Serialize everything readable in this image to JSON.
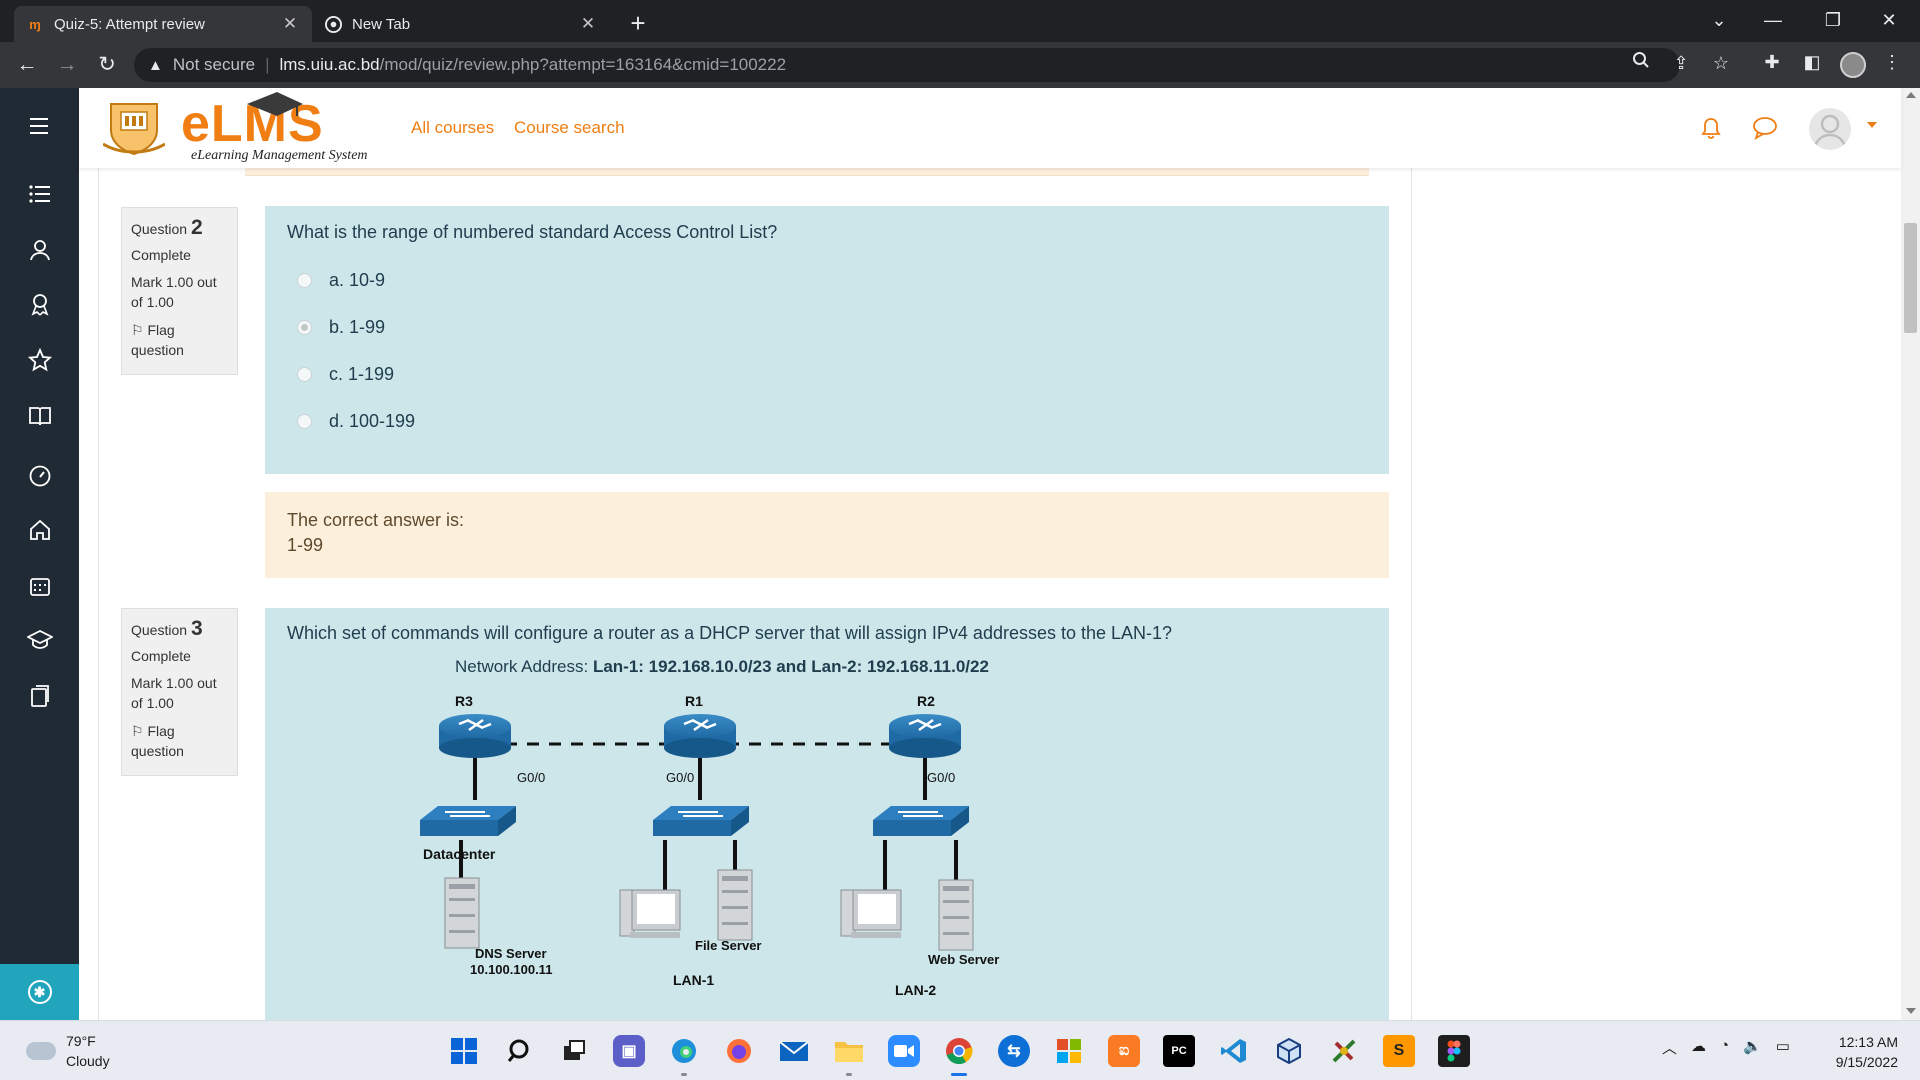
{
  "browser": {
    "tabs": [
      {
        "title": "Quiz-5: Attempt review",
        "active": true,
        "favicon": "elms-favicon"
      },
      {
        "title": "New Tab",
        "active": false,
        "favicon": "chrome-favicon"
      }
    ],
    "address": {
      "security": "Not secure",
      "host": "lms.uiu.ac.bd",
      "path": "/mod/quiz/review.php?attempt=163164&cmid=100222"
    }
  },
  "site": {
    "logo_text": "eLMS",
    "logo_subtitle": "eLearning Management System",
    "nav": [
      "All courses",
      "Course search"
    ],
    "accent": "#f07e12"
  },
  "questions": [
    {
      "number_label": "Question",
      "number": "2",
      "state": "Complete",
      "grade": "Mark 1.00 out of 1.00",
      "flag": "Flag question",
      "text": "What is the range of numbered standard Access Control List?",
      "answers": [
        {
          "label": "a. 10-9",
          "checked": false
        },
        {
          "label": "b. 1-99",
          "checked": true
        },
        {
          "label": "c. 1-199",
          "checked": false
        },
        {
          "label": "d. 100-199",
          "checked": false
        }
      ],
      "feedback_title": "The correct answer is:",
      "feedback_answer": "1-99"
    },
    {
      "number_label": "Question",
      "number": "3",
      "state": "Complete",
      "grade": "Mark 1.00 out of 1.00",
      "flag": "Flag question",
      "text": "Which set of commands will configure a router as a DHCP server that will assign IPv4  addresses to the LAN-1?",
      "network_prefix": "Network Address: ",
      "network_value": "Lan-1: 192.168.10.0/23 and Lan-2: 192.168.11.0/22"
    }
  ],
  "diagram": {
    "routers": [
      "R3",
      "R1",
      "R2"
    ],
    "interfaces": [
      "G0/0",
      "G0/0",
      "G0/0"
    ],
    "datacenter": "Datacenter",
    "dns_server": "DNS Server",
    "dns_ip": "10.100.100.11",
    "file_server": "File Server",
    "web_server": "Web Server",
    "lan1": "LAN-1",
    "lan2": "LAN-2"
  },
  "taskbar": {
    "temp": "79°F",
    "condition": "Cloudy",
    "time": "12:13 AM",
    "date": "9/15/2022"
  }
}
